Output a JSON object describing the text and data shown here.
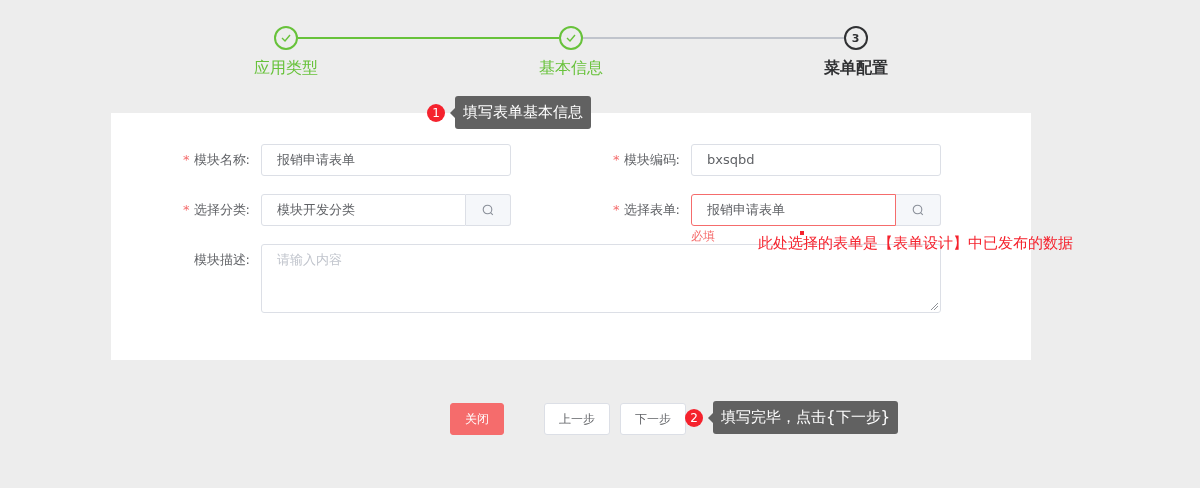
{
  "steps": [
    {
      "label": "应用类型",
      "done": true
    },
    {
      "label": "基本信息",
      "done": true
    },
    {
      "label": "菜单配置",
      "number": "3",
      "done": false
    }
  ],
  "form": {
    "fields": [
      {
        "label": "模块名称:",
        "required_mark": "*",
        "kind": "input",
        "value": "报销申请表单"
      },
      {
        "label": "模块编码:",
        "required_mark": "*",
        "kind": "input",
        "value": "bxsqbd"
      },
      {
        "label": "选择分类:",
        "required_mark": "*",
        "kind": "lookup",
        "value": "模块开发分类"
      },
      {
        "label": "选择表单:",
        "required_mark": "*",
        "kind": "lookup",
        "value": "报销申请表单",
        "error": "必填"
      },
      {
        "label": "模块描述:",
        "kind": "textarea",
        "placeholder": "请输入内容"
      }
    ]
  },
  "buttons": [
    {
      "label": "关闭",
      "kind": "danger"
    },
    {
      "label": "上一步",
      "kind": "default"
    },
    {
      "label": "下一步",
      "kind": "default"
    }
  ],
  "annotations": [
    {
      "number": "1",
      "text": "填写表单基本信息"
    },
    {
      "number": "2",
      "text": "填写完毕，点击{下一步}"
    }
  ],
  "note": "此处选择的表单是【表单设计】中已发布的数据"
}
